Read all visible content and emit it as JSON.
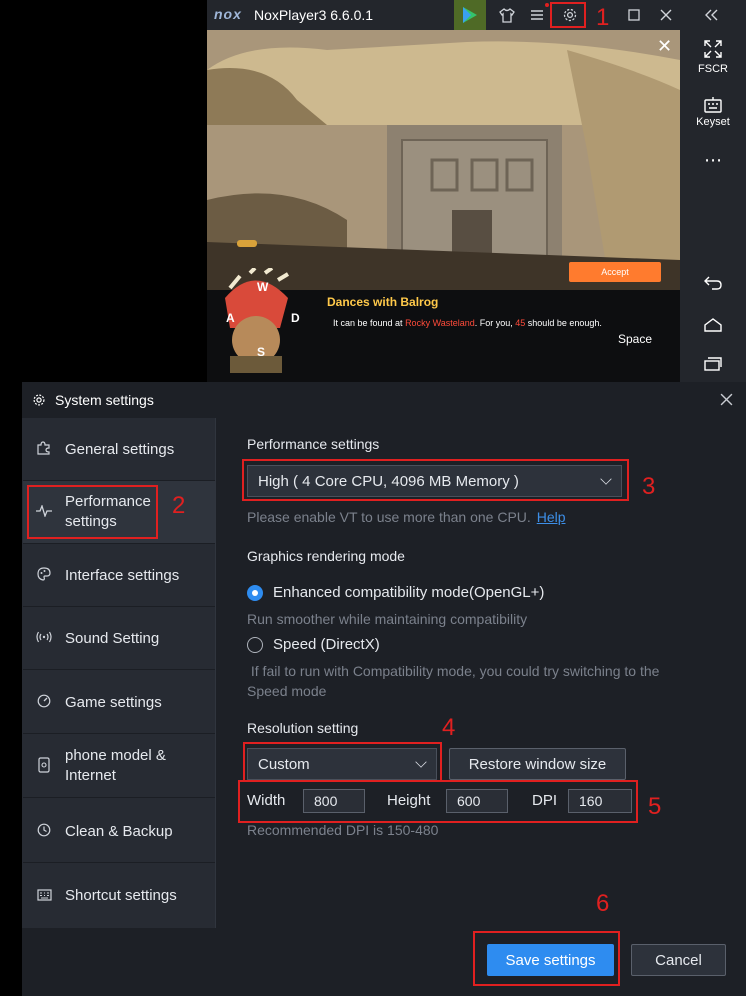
{
  "nox": {
    "logo": "nox",
    "title": "NoxPlayer3 6.6.0.1",
    "sidebar": {
      "fscr": "FSCR",
      "keyset": "Keyset",
      "more": "⋯"
    }
  },
  "game": {
    "quest_title": "Dances with Balrog",
    "quest_text_prefix": "It can be found at ",
    "quest_location": "Rocky Wasteland",
    "quest_text_mid": ". For you, ",
    "quest_number": "45",
    "quest_text_suffix": " should be enough.",
    "accept": "Accept",
    "space": "Space",
    "keys": {
      "w": "W",
      "a": "A",
      "s": "S",
      "d": "D"
    }
  },
  "settings": {
    "title": "System settings",
    "nav": [
      {
        "label": "General settings",
        "icon": "puzzle-icon"
      },
      {
        "label": "Performance settings",
        "icon": "pulse-icon"
      },
      {
        "label": "Interface settings",
        "icon": "palette-icon"
      },
      {
        "label": "Sound Setting",
        "icon": "sound-icon"
      },
      {
        "label": "Game settings",
        "icon": "gauge-icon"
      },
      {
        "label": "phone model & Internet",
        "icon": "phone-icon"
      },
      {
        "label": "Clean & Backup",
        "icon": "clock-icon"
      },
      {
        "label": "Shortcut settings",
        "icon": "keyboard-icon"
      }
    ],
    "performance": {
      "heading": "Performance settings",
      "selected": "High ( 4 Core CPU, 4096 MB Memory )",
      "vt_note": "Please enable VT to use more than one CPU.",
      "help": "Help"
    },
    "graphics": {
      "heading": "Graphics rendering mode",
      "opt1": "Enhanced compatibility mode(OpenGL+)",
      "opt1_desc": "Run smoother while maintaining compatibility",
      "opt2": "Speed (DirectX)",
      "opt2_desc_line1": " If fail to run with Compatibility mode, you could try switching to the",
      "opt2_desc_line2": "Speed mode"
    },
    "resolution": {
      "heading": "Resolution setting",
      "selected": "Custom",
      "restore": "Restore window size",
      "width_label": "Width",
      "width": "800",
      "height_label": "Height",
      "height": "600",
      "dpi_label": "DPI",
      "dpi": "160",
      "dpi_note": "Recommended DPI is 150-480"
    },
    "save": "Save settings",
    "cancel": "Cancel"
  },
  "annotations": [
    "1",
    "2",
    "3",
    "4",
    "5",
    "6"
  ],
  "colors": {
    "accent": "#2e8cf0",
    "annotation": "#e02020",
    "quest_red": "#ff4b3a"
  }
}
